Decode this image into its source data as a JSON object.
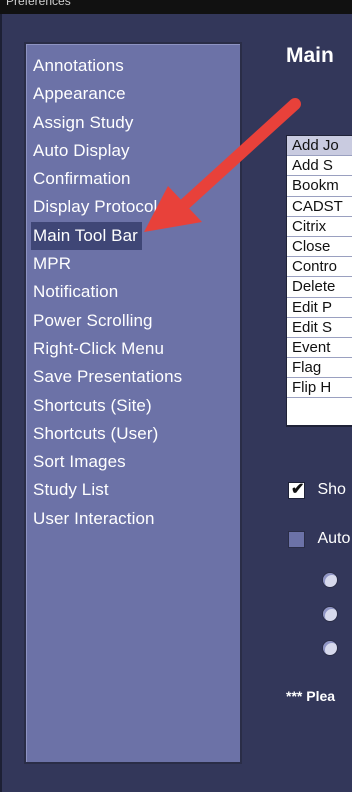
{
  "window": {
    "title": "Preferences"
  },
  "nav": {
    "items": [
      {
        "label": "Annotations"
      },
      {
        "label": "Appearance"
      },
      {
        "label": "Assign Study"
      },
      {
        "label": "Auto Display"
      },
      {
        "label": "Confirmation"
      },
      {
        "label": "Display Protocol"
      },
      {
        "label": "Main Tool Bar",
        "selected": true
      },
      {
        "label": "MPR"
      },
      {
        "label": "Notification"
      },
      {
        "label": "Power Scrolling"
      },
      {
        "label": "Right-Click Menu"
      },
      {
        "label": "Save Presentations"
      },
      {
        "label": "Shortcuts (Site)"
      },
      {
        "label": "Shortcuts (User)"
      },
      {
        "label": "Sort Images"
      },
      {
        "label": "Study List"
      },
      {
        "label": "User Interaction"
      }
    ]
  },
  "main": {
    "title": "Main",
    "tool_list": [
      {
        "label": "Add Jo",
        "selected": true
      },
      {
        "label": "Add S"
      },
      {
        "label": "Bookm"
      },
      {
        "label": "CADST"
      },
      {
        "label": "Citrix"
      },
      {
        "label": "Close"
      },
      {
        "label": "Contro"
      },
      {
        "label": "Delete"
      },
      {
        "label": "Edit P"
      },
      {
        "label": "Edit S"
      },
      {
        "label": "Event"
      },
      {
        "label": "Flag"
      },
      {
        "label": "Flip H"
      }
    ],
    "show_checkbox": {
      "label": "Sho",
      "checked": true
    },
    "auto_checkbox": {
      "label": "Auto",
      "checked": false
    },
    "notice": "*** Plea"
  },
  "annotation": {
    "arrow_color": "#e8413a"
  }
}
